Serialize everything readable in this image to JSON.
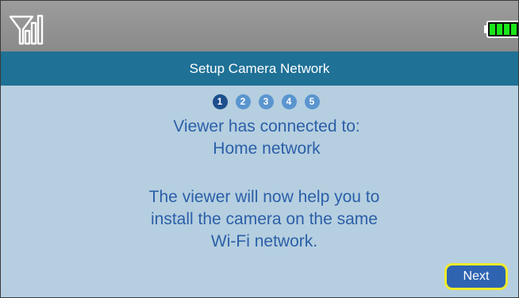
{
  "status_bar": {
    "signal_icon": "signal-strength-icon",
    "battery_icon": "battery-icon",
    "battery_color": "#19e619"
  },
  "title": "Setup Camera Network",
  "steps": [
    "1",
    "2",
    "3",
    "4",
    "5"
  ],
  "current_step": 1,
  "messages": {
    "connected_label": "Viewer has connected to:",
    "network_name": "Home network",
    "help_lines": [
      "The viewer will now help you to",
      "install the camera on the same",
      "Wi-Fi network."
    ]
  },
  "next_label": "Next",
  "colors": {
    "title_bar": "#1f7196",
    "background": "#b5cfe0",
    "text": "#2c5fa8",
    "step_active": "#1d4f8c",
    "step_inactive": "#5a95cf",
    "focus_ring": "#f0ec2a"
  }
}
